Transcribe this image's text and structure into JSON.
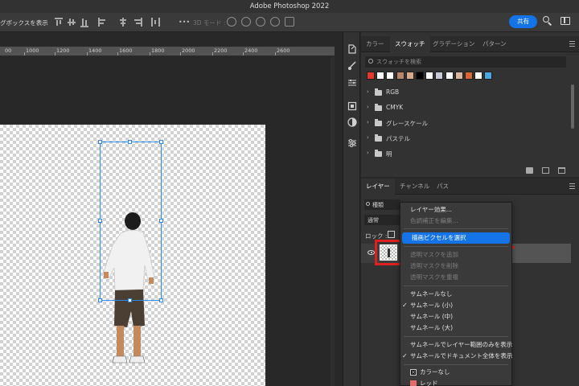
{
  "app": {
    "title": "Adobe Photoshop 2022"
  },
  "options_bar": {
    "auto_select_label": "グボックスを表示",
    "mode_3d_label": "3D モード :",
    "more_label": "•••",
    "share_label": "共有"
  },
  "ruler": {
    "labels": [
      "00",
      "1000",
      "1200",
      "1400",
      "1600",
      "1800",
      "2000",
      "2200",
      "2400",
      "2600"
    ]
  },
  "swatch_panel": {
    "tabs": [
      "カラー",
      "スウォッチ",
      "グラデーション",
      "パターン"
    ],
    "active_tab": "スウォッチ",
    "search_placeholder": "スウォッチを検索",
    "swatch_colors": [
      "#e5382b",
      "#ffffff",
      "#ffffff",
      "#b9856a",
      "#d6a98f",
      "#000000",
      "#ffffff",
      "#c8ccd8",
      "#ffffff",
      "#d9b7a0",
      "#d96830",
      "#ffffff",
      "#4aa7e0"
    ],
    "folders": [
      "RGB",
      "CMYK",
      "グレースケール",
      "パステル",
      "明"
    ]
  },
  "layers_panel": {
    "tabs": [
      "レイヤー",
      "チャンネル",
      "パス"
    ],
    "active_tab": "レイヤー",
    "filter_label": "種類",
    "blend_mode": "通常",
    "lock_label": "ロック :"
  },
  "context_menu": {
    "items": [
      {
        "label": "レイヤー効果...",
        "enabled": true
      },
      {
        "label": "色調補正を編集...",
        "enabled": false
      },
      {
        "label": "描画ピクセルを選択",
        "enabled": true,
        "highlighted": true
      },
      {
        "label": "透明マスクを追加",
        "enabled": false
      },
      {
        "label": "透明マスクを削除",
        "enabled": false
      },
      {
        "label": "透明マスクを重複",
        "enabled": false
      },
      {
        "label": "サムネールなし",
        "enabled": true
      },
      {
        "label": "サムネール (小)",
        "enabled": true,
        "checked": true
      },
      {
        "label": "サムネール (中)",
        "enabled": true
      },
      {
        "label": "サムネール (大)",
        "enabled": true
      },
      {
        "label": "サムネールでレイヤー範囲のみを表示",
        "enabled": true
      },
      {
        "label": "サムネールでドキュメント全体を表示",
        "enabled": true,
        "checked": true
      },
      {
        "label": "カラーなし",
        "enabled": true,
        "color": "none"
      },
      {
        "label": "レッド",
        "enabled": true,
        "color": "#e46b6b"
      }
    ]
  }
}
